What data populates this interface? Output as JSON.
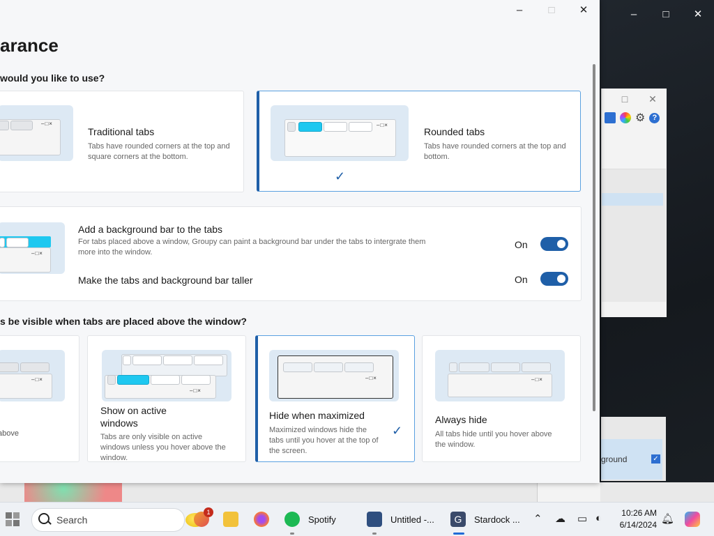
{
  "window": {
    "title": "arance",
    "controls": {
      "minimize": "–",
      "maximize": "□",
      "close": "✕"
    }
  },
  "tab_style": {
    "question": "would you like to use?",
    "options": [
      {
        "title": "Traditional tabs",
        "desc": "Tabs have rounded corners at the top and square corners at the bottom.",
        "selected": false
      },
      {
        "title": "Rounded tabs",
        "desc": "Tabs have rounded corners at the top and bottom.",
        "selected": true
      }
    ]
  },
  "background_bar": {
    "add_title": "Add a background bar to the tabs",
    "add_desc": "For tabs placed above a window, Groupy can paint a background bar under the tabs to intergrate them more into the window.",
    "add_state": "On",
    "taller_title": "Make the tabs and background bar taller",
    "taller_state": "On"
  },
  "visibility": {
    "question": "s be visible when tabs are placed above the window?",
    "options": [
      {
        "title": "",
        "desc": "above",
        "selected": false
      },
      {
        "title": "Show on active windows",
        "desc": "Tabs are only visible on active windows unless you hover above the window.",
        "selected": false
      },
      {
        "title": "Hide when maximized",
        "desc": "Maximized windows hide the tabs until you hover at the top of the screen.",
        "selected": true
      },
      {
        "title": "Always hide",
        "desc": "All tabs hide until you hover above the window.",
        "selected": false
      }
    ]
  },
  "background_window": {
    "controls": {
      "minimize": "–",
      "maximize": "□",
      "close": "✕"
    },
    "small_controls": {
      "maximize": "□",
      "close": "✕"
    },
    "list_text": "ground"
  },
  "taskbar": {
    "search_placeholder": "Search",
    "notification_count": "1",
    "apps": [
      {
        "label": "Spotify"
      },
      {
        "label": "Untitled -..."
      },
      {
        "label": "Stardock ..."
      }
    ],
    "time": "10:26 AM",
    "date": "6/14/2024"
  },
  "colors": {
    "accent": "#1f5fa8",
    "active_tab": "#1ec8f0",
    "taskbar_bg": "#eef1f5"
  }
}
